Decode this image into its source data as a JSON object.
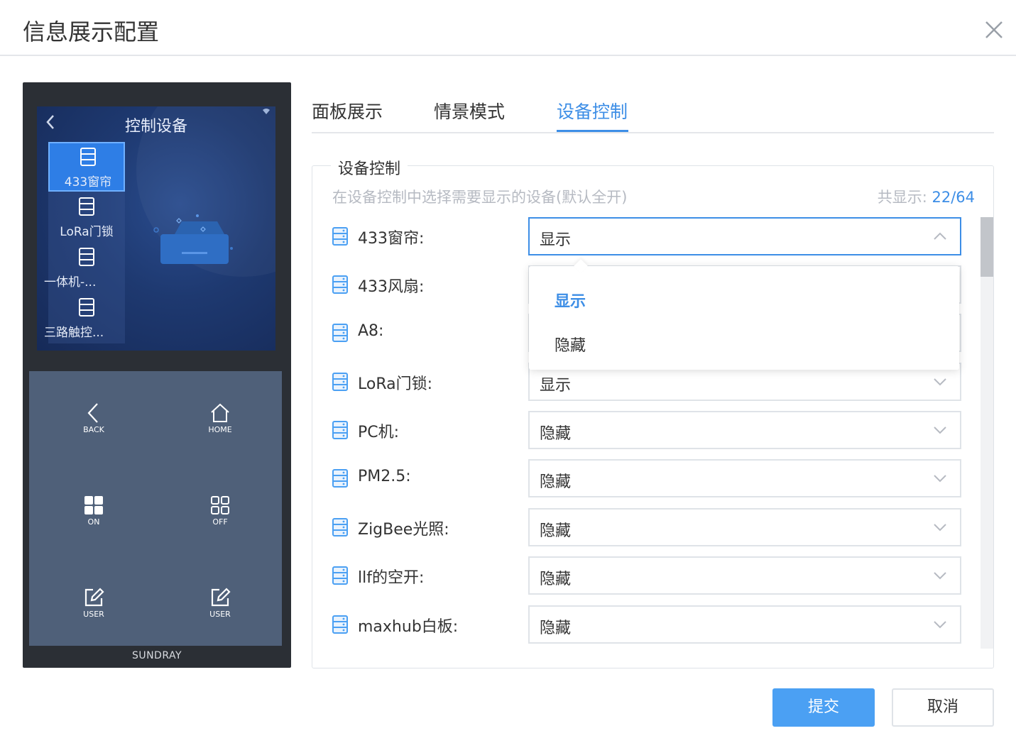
{
  "dialog": {
    "title": "信息展示配置"
  },
  "preview": {
    "screen_title": "控制设备",
    "devices": [
      "433窗帘",
      "LoRa门锁",
      "一体机-...",
      "三路触控..."
    ],
    "buttons": [
      {
        "label": "BACK",
        "icon": "back-arrow-icon"
      },
      {
        "label": "HOME",
        "icon": "home-icon"
      },
      {
        "label": "ON",
        "icon": "grid-filled-icon"
      },
      {
        "label": "OFF",
        "icon": "grid-outline-icon"
      },
      {
        "label": "USER",
        "icon": "edit-icon"
      },
      {
        "label": "USER",
        "icon": "edit-icon"
      }
    ],
    "brand": "SUNDRAY"
  },
  "tabs": [
    {
      "label": "面板展示",
      "active": false
    },
    {
      "label": "情景模式",
      "active": false
    },
    {
      "label": "设备控制",
      "active": true
    }
  ],
  "device_control": {
    "legend": "设备控制",
    "hint": "在设备控制中选择需要显示的设备(默认全开)",
    "count_label": "共显示:",
    "count_current": "22",
    "count_total": "/64",
    "rows": [
      {
        "label": "433窗帘:",
        "value": "显示"
      },
      {
        "label": "433风扇:",
        "value": ""
      },
      {
        "label": "A8:",
        "value": ""
      },
      {
        "label": "LoRa门锁:",
        "value": "显示"
      },
      {
        "label": "PC机:",
        "value": "隐藏"
      },
      {
        "label": "PM2.5:",
        "value": "隐藏"
      },
      {
        "label": "ZigBee光照:",
        "value": "隐藏"
      },
      {
        "label": "llf的空开:",
        "value": "隐藏"
      },
      {
        "label": "maxhub白板:",
        "value": "隐藏"
      }
    ],
    "dropdown_options": [
      "显示",
      "隐藏"
    ],
    "dropdown_selected": "显示"
  },
  "footer": {
    "submit": "提交",
    "cancel": "取消"
  },
  "colors": {
    "accent": "#3d8ee6",
    "submit_bg": "#4ba0f3",
    "panel_bg": "#4f6079",
    "screen_bg": "#1e3970"
  }
}
